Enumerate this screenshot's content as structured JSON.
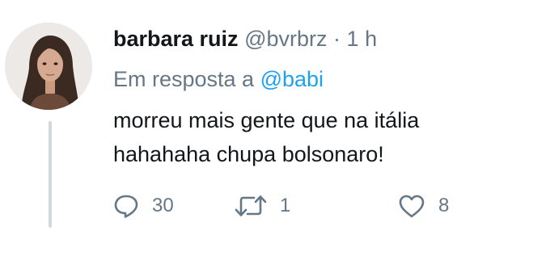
{
  "tweet": {
    "author_name": "barbara ruiz",
    "author_handle": "@bvrbrz",
    "separator": "·",
    "time": "1 h",
    "reply_prefix": "Em resposta a",
    "reply_mention": "@babi",
    "text_lines": [
      "morreu mais gente que na itália",
      "hahahaha chupa bolsonaro!"
    ],
    "reply_count": "30",
    "retweet_count": "1",
    "like_count": "8"
  },
  "icons": {
    "reply": "speech-bubble-icon",
    "retweet": "retweet-icon",
    "like": "heart-icon"
  },
  "colors": {
    "name": "#14171a",
    "secondary": "#657786",
    "link": "#1da1f2",
    "thread_line": "#cfd9de"
  }
}
